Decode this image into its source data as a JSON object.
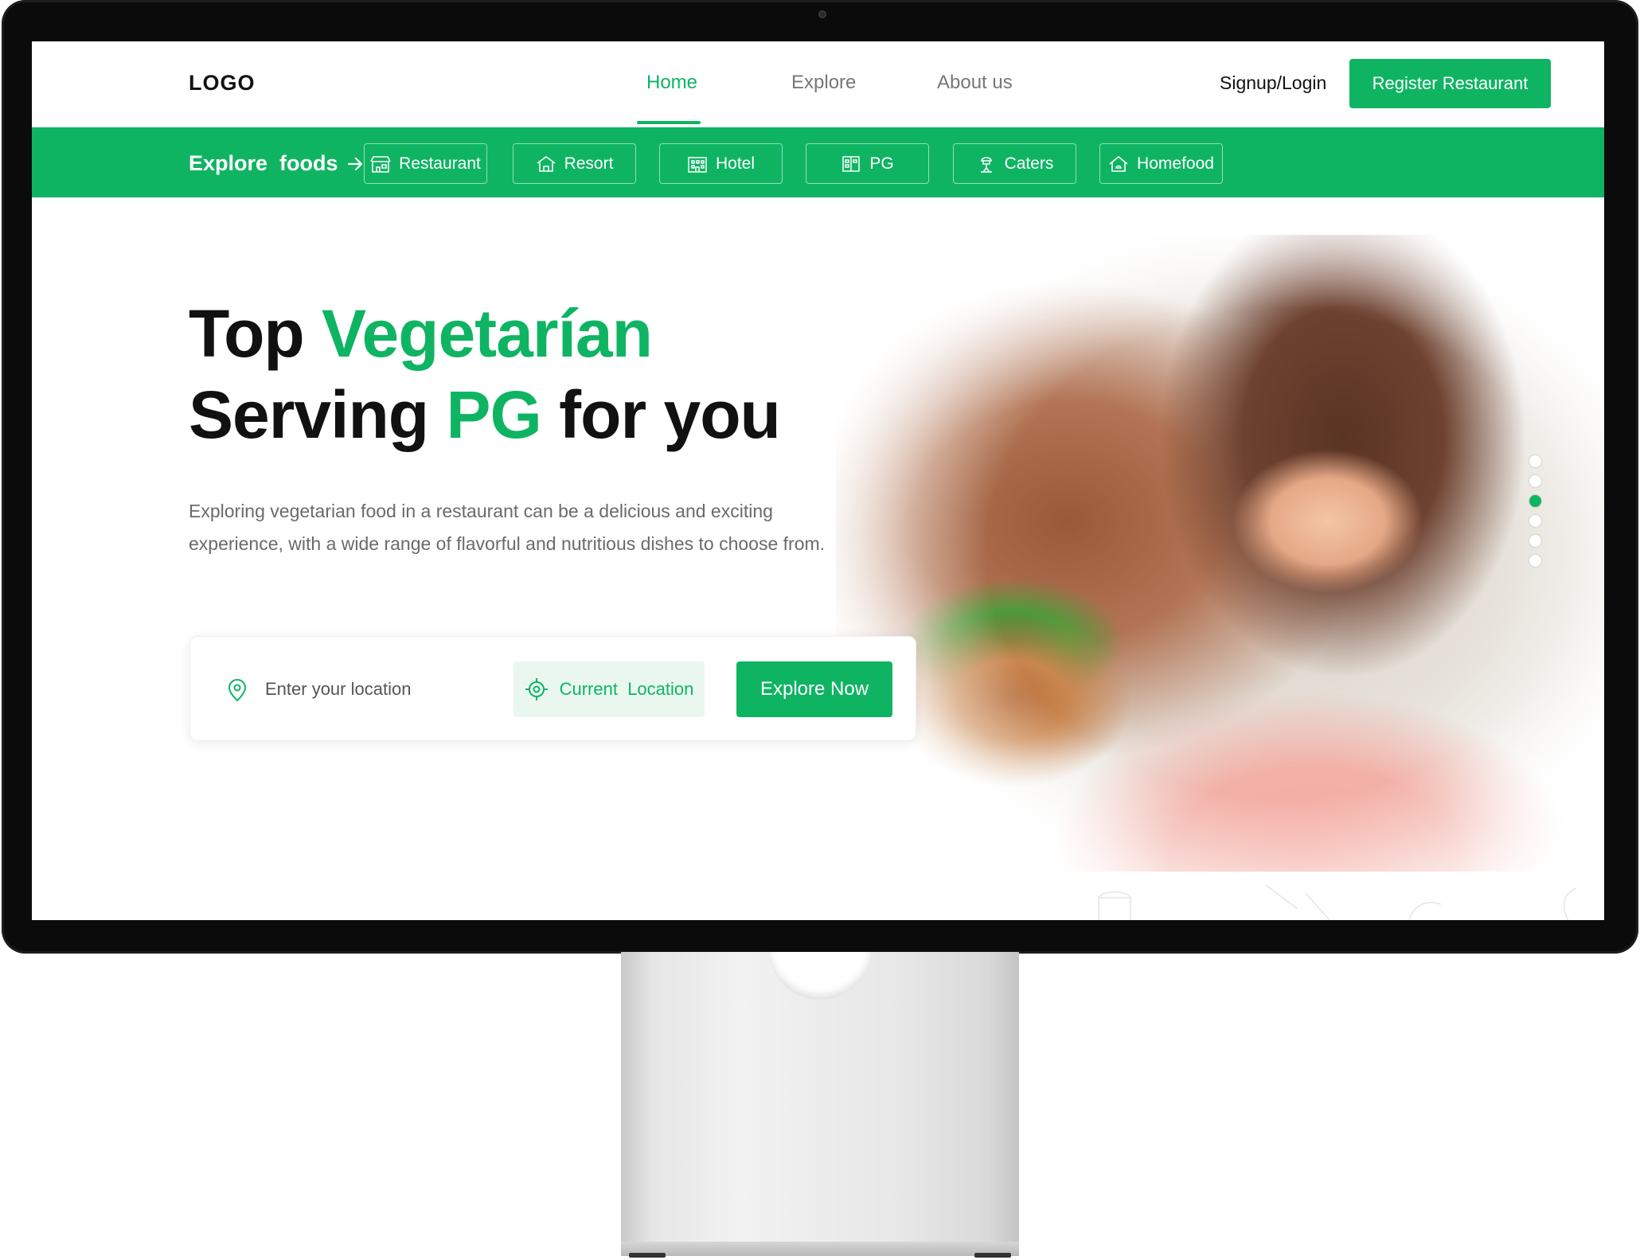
{
  "header": {
    "logo": "LOGO",
    "nav": [
      {
        "label": "Home",
        "active": true
      },
      {
        "label": "Explore",
        "active": false
      },
      {
        "label": "About us",
        "active": false
      }
    ],
    "signup_label": "Signup/Login",
    "register_label": "Register Restaurant"
  },
  "category_bar": {
    "title": "Explore  foods",
    "categories": [
      {
        "label": "Restaurant",
        "icon": "restaurant-icon"
      },
      {
        "label": "Resort",
        "icon": "resort-icon"
      },
      {
        "label": "Hotel",
        "icon": "hotel-icon"
      },
      {
        "label": "PG",
        "icon": "pg-icon"
      },
      {
        "label": "Caters",
        "icon": "caters-icon"
      },
      {
        "label": "Homefood",
        "icon": "homefood-icon"
      }
    ]
  },
  "hero": {
    "title_line1_a": "Top ",
    "title_line1_b": "Vegetarían",
    "title_line2_a": "Serving ",
    "title_line2_b": "PG",
    "title_line2_c": " for you",
    "description": "Exploring vegetarian food in a restaurant can be a delicious and exciting experience, with a wide range of flavorful and nutritious dishes to choose from.",
    "carousel": {
      "total": 6,
      "active_index": 2
    }
  },
  "search": {
    "placeholder": "Enter your location",
    "current_location_label": "Current  Location",
    "explore_button_label": "Explore Now"
  },
  "colors": {
    "brand_green": "#0fb463",
    "light_green": "#e9f7ef",
    "text_dark": "#111111",
    "text_muted": "#6a6a6a"
  }
}
